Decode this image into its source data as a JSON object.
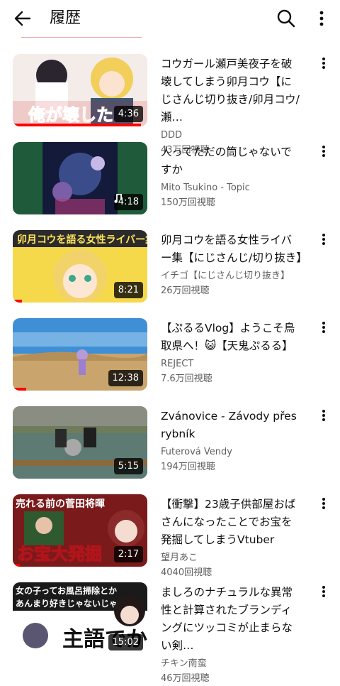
{
  "header": {
    "title": "履歴",
    "icons": {
      "back": "arrow-left-icon",
      "search": "search-icon",
      "more": "more-vertical-icon"
    },
    "accent": "#ff0000"
  },
  "videos": [
    {
      "title": "コウガール瀬戸美夜子を破壊してしまう卯月コウ【にじさんじ切り抜き/卯月コウ/瀬…",
      "channel": "DDD",
      "views": "43万回視聴",
      "duration": "4:36",
      "thumb_text": "俺が壊した",
      "watched": 0.95
    },
    {
      "title": "人ってただの筒じゃないですか",
      "channel": "Mito Tsukino - Topic",
      "views": "150万回視聴",
      "duration": "4:18",
      "music": true,
      "watched": 0.0
    },
    {
      "title": "卯月コウを語る女性ライバー集【にじさんじ/切り抜き】",
      "channel": "イチゴ【にじさんじ切り抜き】",
      "views": "26万回視聴",
      "duration": "8:21",
      "thumb_text": "卯月コウを語る女性ライバー集",
      "watched": 0.07
    },
    {
      "title": "【ぷるるVlog】ようこそ鳥取県へ！😺【天鬼ぷるる】",
      "channel": "REJECT",
      "views": "7.6万回視聴",
      "duration": "12:38",
      "watched": 0.1
    },
    {
      "title": "Zvánovice - Závody přes rybník",
      "channel": "Futerová Vendy",
      "views": "194万回視聴",
      "duration": "5:15",
      "watched": 0.0
    },
    {
      "title": "【衝撃】23歳子供部屋おばさんになったことでお宝を発掘してしまうVtuber",
      "channel": "望月あこ",
      "views": "4040回視聴",
      "duration": "2:17",
      "thumb_text": "お宝大発掘",
      "thumb_text_2": "売れる前の菅田将暉",
      "watched": 0.05
    },
    {
      "title": "ましろのナチュラルな異常性と計算されたブランディングにツッコミが止まらない剣…",
      "channel": "チキン南蛮",
      "views": "46万回視聴",
      "duration": "15:02",
      "thumb_text": "主語でか",
      "thumb_text_2": "女の子ってお風呂掃除とか",
      "thumb_text_3": "あんまり好きじゃないじゃん",
      "watched": 0.0
    }
  ]
}
